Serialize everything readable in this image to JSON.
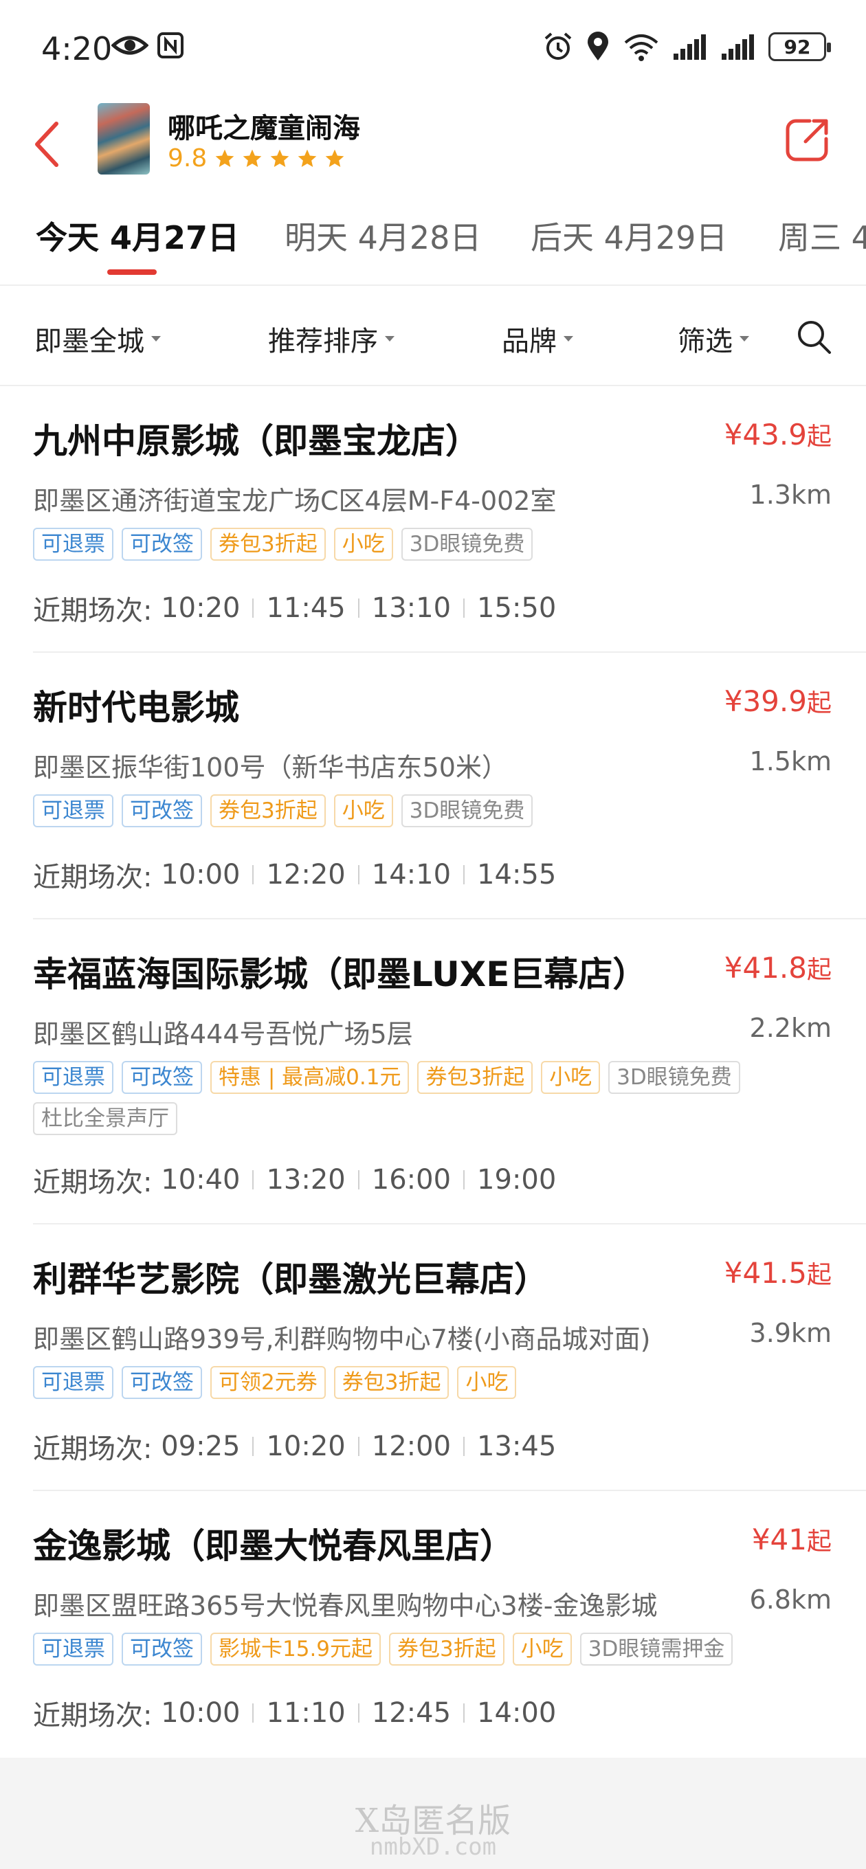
{
  "status_bar": {
    "time": "4:20",
    "battery": "92"
  },
  "header": {
    "movie_title": "哪吒之魔童闹海",
    "rating": "9.8",
    "stars": 5
  },
  "date_tabs": [
    {
      "label": "今天 4月27日",
      "active": true
    },
    {
      "label": "明天 4月28日",
      "active": false
    },
    {
      "label": "后天 4月29日",
      "active": false
    },
    {
      "label": "周三 4",
      "active": false
    }
  ],
  "filters": {
    "area": "即墨全城",
    "sort": "推荐排序",
    "brand": "品牌",
    "filter": "筛选"
  },
  "cinemas": [
    {
      "name": "九州中原影城（即墨宝龙店）",
      "price": "¥43.9",
      "price_suffix": "起",
      "address": "即墨区通济街道宝龙广场C区4层M-F4-002室",
      "distance": "1.3km",
      "tags": [
        {
          "text": "可退票",
          "style": "blue"
        },
        {
          "text": "可改签",
          "style": "blue"
        },
        {
          "text": "券包3折起",
          "style": "orange"
        },
        {
          "text": "小吃",
          "style": "orange"
        },
        {
          "text": "3D眼镜免费",
          "style": "gray"
        }
      ],
      "sessions_label": "近期场次: ",
      "sessions": [
        "10:20",
        "11:45",
        "13:10",
        "15:50"
      ]
    },
    {
      "name": "新时代电影城",
      "price": "¥39.9",
      "price_suffix": "起",
      "address": "即墨区振华街100号（新华书店东50米）",
      "distance": "1.5km",
      "tags": [
        {
          "text": "可退票",
          "style": "blue"
        },
        {
          "text": "可改签",
          "style": "blue"
        },
        {
          "text": "券包3折起",
          "style": "orange"
        },
        {
          "text": "小吃",
          "style": "orange"
        },
        {
          "text": "3D眼镜免费",
          "style": "gray"
        }
      ],
      "sessions_label": "近期场次: ",
      "sessions": [
        "10:00",
        "12:20",
        "14:10",
        "14:55"
      ]
    },
    {
      "name": "幸福蓝海国际影城（即墨LUXE巨幕店）",
      "price": "¥41.8",
      "price_suffix": "起",
      "address": "即墨区鹤山路444号吾悦广场5层",
      "distance": "2.2km",
      "tags": [
        {
          "text": "可退票",
          "style": "blue"
        },
        {
          "text": "可改签",
          "style": "blue"
        },
        {
          "text": "特惠 | 最高减0.1元",
          "style": "orange"
        },
        {
          "text": "券包3折起",
          "style": "orange"
        },
        {
          "text": "小吃",
          "style": "orange"
        },
        {
          "text": "3D眼镜免费",
          "style": "gray"
        },
        {
          "text": "杜比全景声厅",
          "style": "gray"
        }
      ],
      "sessions_label": "近期场次: ",
      "sessions": [
        "10:40",
        "13:20",
        "16:00",
        "19:00"
      ]
    },
    {
      "name": "利群华艺影院（即墨激光巨幕店）",
      "price": "¥41.5",
      "price_suffix": "起",
      "address": "即墨区鹤山路939号,利群购物中心7楼(小商品城对面)",
      "distance": "3.9km",
      "tags": [
        {
          "text": "可退票",
          "style": "blue"
        },
        {
          "text": "可改签",
          "style": "blue"
        },
        {
          "text": "可领2元券",
          "style": "orange"
        },
        {
          "text": "券包3折起",
          "style": "orange"
        },
        {
          "text": "小吃",
          "style": "orange"
        }
      ],
      "sessions_label": "近期场次: ",
      "sessions": [
        "09:25",
        "10:20",
        "12:00",
        "13:45"
      ]
    },
    {
      "name": "金逸影城（即墨大悦春风里店）",
      "price": "¥41",
      "price_suffix": "起",
      "address": "即墨区盟旺路365号大悦春风里购物中心3楼-金逸影城",
      "distance": "6.8km",
      "tags": [
        {
          "text": "可退票",
          "style": "blue"
        },
        {
          "text": "可改签",
          "style": "blue"
        },
        {
          "text": "影城卡15.9元起",
          "style": "orange"
        },
        {
          "text": "券包3折起",
          "style": "orange"
        },
        {
          "text": "小吃",
          "style": "orange"
        },
        {
          "text": "3D眼镜需押金",
          "style": "gray"
        }
      ],
      "sessions_label": "近期场次: ",
      "sessions": [
        "10:00",
        "11:10",
        "12:45",
        "14:00"
      ]
    }
  ],
  "footer": {
    "watermark_line1": "X岛匿名版",
    "watermark_line2": "nmbXD.com"
  },
  "colors": {
    "accent_red": "#e23a32",
    "price_red": "#e4433b",
    "rating_gold": "#f3a21c",
    "tag_blue": "#3b86d0",
    "tag_orange": "#ef9a1a"
  }
}
